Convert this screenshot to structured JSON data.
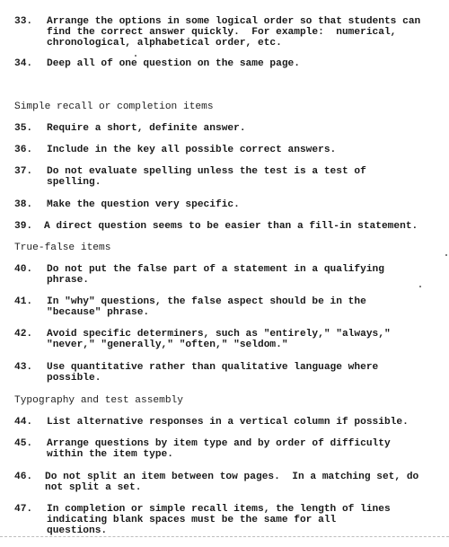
{
  "items": [
    {
      "num": "33.",
      "lines": [
        "Arrange the options in some logical order so that students can",
        "find the correct answer quickly.  For example:  numerical,",
        "chronological, alphabetical order, etc."
      ]
    },
    {
      "num": "34.",
      "lines": [
        "Deep all of one question on the same page."
      ]
    },
    {
      "num": "35.",
      "lines": [
        "Require a short, definite answer."
      ]
    },
    {
      "num": "36.",
      "lines": [
        "Include in the key all possible correct answers."
      ]
    },
    {
      "num": "37.",
      "lines": [
        "Do not evaluate spelling unless the test is a test of",
        "spelling."
      ]
    },
    {
      "num": "38.",
      "lines": [
        "Make the question very specific."
      ]
    },
    {
      "num": "39.",
      "lines": [
        "A direct question seems to be easier than a fill-in statement."
      ]
    },
    {
      "num": "40.",
      "lines": [
        "Do not put the false part of a statement in a qualifying",
        "phrase."
      ]
    },
    {
      "num": "41.",
      "lines": [
        "In \"why\" questions, the false aspect should be in the",
        "\"because\" phrase."
      ]
    },
    {
      "num": "42.",
      "lines": [
        "Avoid specific determiners, such as \"entirely,\" \"always,\"",
        "\"never,\" \"generally,\" \"often,\" \"seldom.\""
      ]
    },
    {
      "num": "43.",
      "lines": [
        "Use quantitative rather than qualitative language where",
        "possible."
      ]
    },
    {
      "num": "44.",
      "lines": [
        "List alternative responses in a vertical column if possible."
      ]
    },
    {
      "num": "45.",
      "lines": [
        "Arrange questions by item type and by order of difficulty",
        "within the item type."
      ]
    },
    {
      "num": "46.",
      "lines": [
        "Do not split an item between tow pages.  In a matching set, do",
        "not split a set."
      ]
    },
    {
      "num": "47.",
      "lines": [
        "In completion or simple recall items, the length of lines",
        "indicating blank spaces must be the same for all",
        "questions."
      ]
    }
  ],
  "headings": {
    "simple_recall": "Simple recall or completion items",
    "true_false": "True-false items",
    "typography": "Typography and test assembly"
  }
}
